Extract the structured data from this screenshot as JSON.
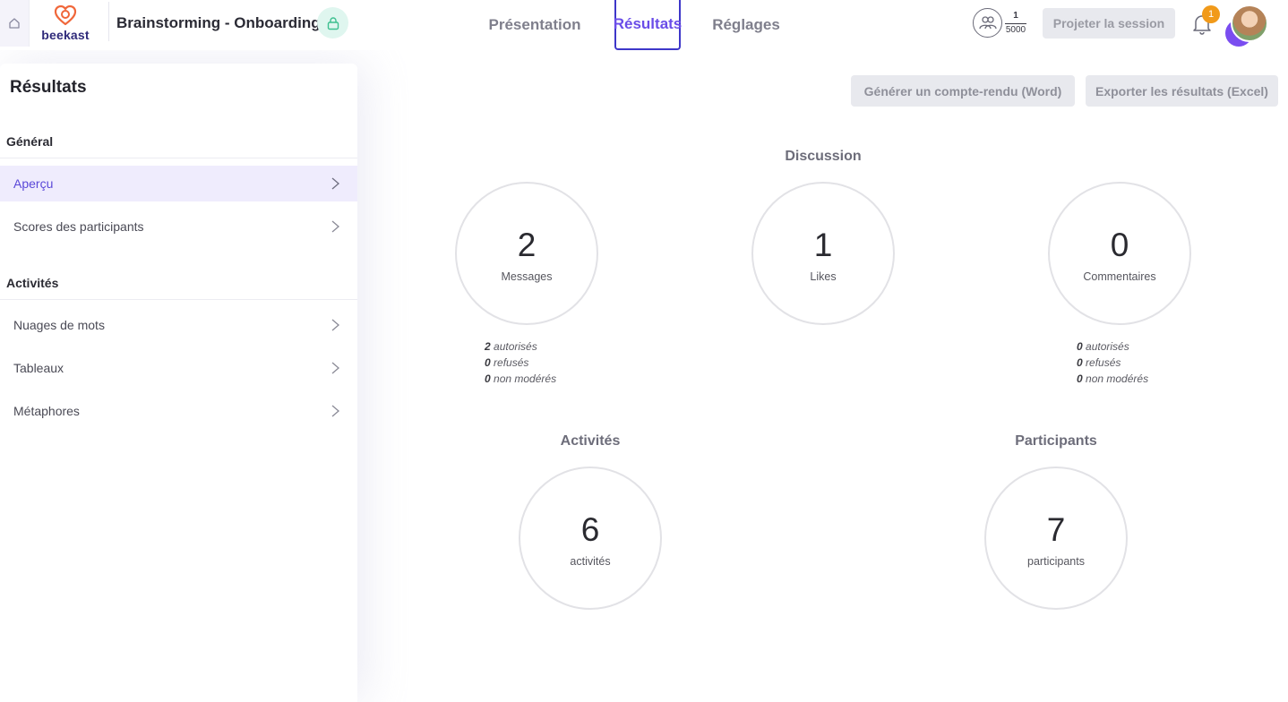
{
  "header": {
    "logo_text": "beekast",
    "session_title": "Brainstorming - Onboarding",
    "tabs": [
      {
        "label": "Présentation"
      },
      {
        "label": "Résultats"
      },
      {
        "label": "Réglages"
      }
    ],
    "participants_current": "1",
    "participants_max": "5000",
    "project_button": "Projeter la session",
    "notification_count": "1"
  },
  "sidebar": {
    "title": "Résultats",
    "sections": [
      {
        "label": "Général"
      },
      {
        "label": "Activités"
      }
    ],
    "items": [
      {
        "label": "Aperçu"
      },
      {
        "label": "Scores des participants"
      },
      {
        "label": "Nuages de mots"
      },
      {
        "label": "Tableaux"
      },
      {
        "label": "Métaphores"
      }
    ]
  },
  "actions": {
    "word_button": "Générer un compte-rendu (Word)",
    "excel_button": "Exporter les résultats (Excel)"
  },
  "discussion": {
    "title": "Discussion",
    "messages": {
      "value": "2",
      "label": "Messages"
    },
    "likes": {
      "value": "1",
      "label": "Likes"
    },
    "comments": {
      "value": "0",
      "label": "Commentaires"
    },
    "messages_breakdown": [
      {
        "count": "2",
        "label": "autorisés"
      },
      {
        "count": "0",
        "label": "refusés"
      },
      {
        "count": "0",
        "label": "non modérés"
      }
    ],
    "comments_breakdown": [
      {
        "count": "0",
        "label": "autorisés"
      },
      {
        "count": "0",
        "label": "refusés"
      },
      {
        "count": "0",
        "label": "non modérés"
      }
    ]
  },
  "activities": {
    "title": "Activités",
    "value": "6",
    "label": "activités"
  },
  "participants": {
    "title": "Participants",
    "value": "7",
    "label": "participants"
  },
  "colors": {
    "accent": "#6a4de8",
    "brand_orange": "#f0673a",
    "badge_orange": "#f19a1a",
    "active_item_bg": "#efecfd"
  }
}
